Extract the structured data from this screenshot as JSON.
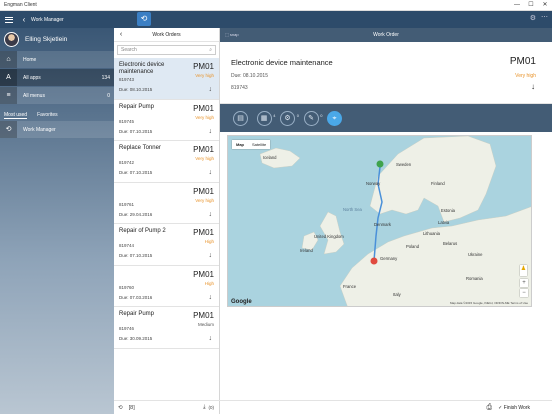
{
  "window": {
    "title": "Engman Client",
    "min": "—",
    "max": "☐",
    "close": "✕"
  },
  "topbar": {
    "module": "Work Manager",
    "sync_glyph": "⟲",
    "user_glyph": "⚙",
    "more_glyph": "⋯"
  },
  "sidebar": {
    "user_name": "Elling Skjetlein",
    "items": [
      {
        "label": "Home",
        "count": "",
        "glyph": "⌂"
      },
      {
        "label": "All apps",
        "count": "134",
        "glyph": "A"
      },
      {
        "label": "All menus",
        "count": "0",
        "glyph": "≡"
      }
    ],
    "tabs": [
      "Most used",
      "Favorites"
    ],
    "apps": [
      {
        "label": "Work Manager",
        "glyph": "⟲"
      }
    ]
  },
  "orders": {
    "title": "Work Orders",
    "search_placeholder": "Search",
    "list": [
      {
        "name": "Electronic device maintenance",
        "code": "PM01",
        "priority": "Very high",
        "priority_color": "#e8932a",
        "id": "819743",
        "due": "Due: 08.10.2015"
      },
      {
        "name": "Repair Pump",
        "code": "PM01",
        "priority": "Very high",
        "priority_color": "#e8932a",
        "id": "819745",
        "due": "Due: 07.10.2015"
      },
      {
        "name": "Replace Tonner",
        "code": "PM01",
        "priority": "Very high",
        "priority_color": "#e8932a",
        "id": "819742",
        "due": "Due: 07.10.2015"
      },
      {
        "name": "",
        "code": "PM01",
        "priority": "Very high",
        "priority_color": "#e8932a",
        "id": "819761",
        "due": "Due: 29.04.2016"
      },
      {
        "name": "Repair of Pump 2",
        "code": "PM01",
        "priority": "High",
        "priority_color": "#e8932a",
        "id": "819744",
        "due": "Due: 07.10.2015"
      },
      {
        "name": "",
        "code": "PM01",
        "priority": "High",
        "priority_color": "#e8932a",
        "id": "819760",
        "due": "Due: 07.03.2016"
      },
      {
        "name": "Repair Pump",
        "code": "PM01",
        "priority": "Medium",
        "priority_color": "#555555",
        "id": "819746",
        "due": "Due: 30.09.2015"
      }
    ],
    "footer_refresh": "⟲",
    "footer_count": "[8]",
    "footer_download": "⤓",
    "footer_download_count": "(0)"
  },
  "main": {
    "header_map_label": "snap",
    "header_title": "Work Order",
    "order_name": "Electronic device maintenance",
    "order_code": "PM01",
    "due": "Due: 08.10.2015",
    "priority": "Very high",
    "priority_color": "#e8932a",
    "id": "819743",
    "down_glyph": "↓",
    "tabs": [
      {
        "glyph": "▤",
        "badge": ""
      },
      {
        "glyph": "▦",
        "badge": "4"
      },
      {
        "glyph": "⚙",
        "badge": "0"
      },
      {
        "glyph": "✎",
        "badge": "0"
      },
      {
        "glyph": "⌖",
        "badge": ""
      }
    ],
    "finish_label": "Finish Work",
    "finish_glyph": "✓",
    "print_glyph": "⎙"
  },
  "map": {
    "tab_map": "Map",
    "tab_satellite": "Satellite",
    "labels": {
      "iceland": "Iceland",
      "norway": "Norway",
      "sweden": "Sweden",
      "finland": "Finland",
      "north_sea": "North Sea",
      "denmark": "Denmark",
      "estonia": "Estonia",
      "latvia": "Latvia",
      "lithuania": "Lithuania",
      "belarus": "Belarus",
      "united_kingdom": "United Kingdom",
      "ireland": "Ireland",
      "poland": "Poland",
      "ukraine": "Ukraine",
      "germany": "Germany",
      "france": "France",
      "romania": "Romania",
      "italy": "Italy"
    },
    "zoom_in": "+",
    "zoom_out": "−",
    "logo": "Google",
    "copyright": "Map data ©2015 Google, INEGI, ORION-ME   Terms of Use",
    "land_color": "#eef0e7",
    "water_color": "#aad3df",
    "route_color": "#4a90d9"
  }
}
